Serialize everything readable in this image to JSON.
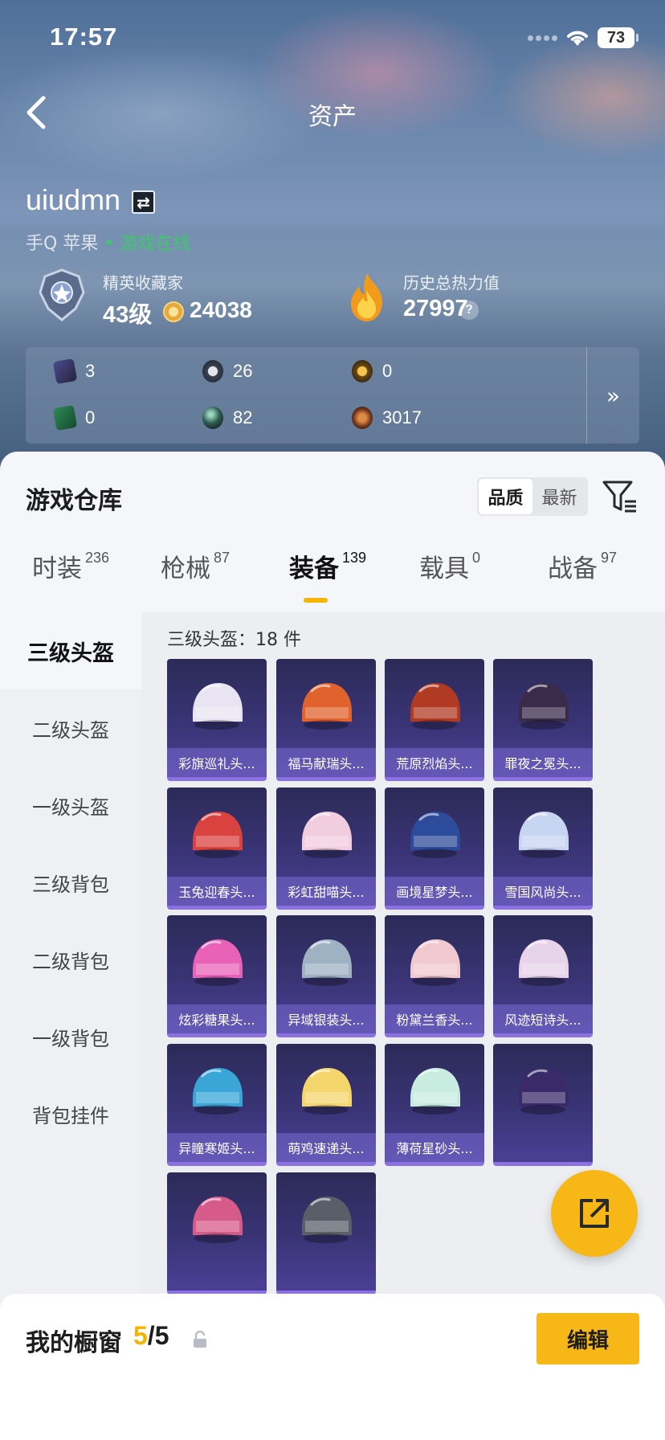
{
  "status_bar": {
    "time": "17:57",
    "battery": "73"
  },
  "header": {
    "title": "资产"
  },
  "user": {
    "name": "uiudmn",
    "switch_symbol": "⇄",
    "platform": "手Q 苹果",
    "separator": "•",
    "online_status": "游戏在线"
  },
  "stats": {
    "rank_label": "精英收藏家",
    "level": "43级",
    "coins": "24038",
    "heat_label": "历史总热力值",
    "heat_value": "27997",
    "help_symbol": "?"
  },
  "resources": [
    {
      "icon": "purple-card-icon",
      "value": "3"
    },
    {
      "icon": "dark-token-icon",
      "value": "26"
    },
    {
      "icon": "gold-token-icon",
      "value": "0"
    },
    {
      "icon": "green-card-icon",
      "value": "0"
    },
    {
      "icon": "green-orb-icon",
      "value": "82"
    },
    {
      "icon": "bronze-coin-icon",
      "value": "3017"
    }
  ],
  "resources_more": "»",
  "warehouse": {
    "title": "游戏仓库",
    "sort_quality": "品质",
    "sort_newest": "最新"
  },
  "tabs": [
    {
      "label": "时装",
      "count": "236"
    },
    {
      "label": "枪械",
      "count": "87"
    },
    {
      "label": "装备",
      "count": "139"
    },
    {
      "label": "载具",
      "count": "0"
    },
    {
      "label": "战备",
      "count": "97"
    }
  ],
  "sidebar": [
    "三级头盔",
    "二级头盔",
    "一级头盔",
    "三级背包",
    "二级背包",
    "一级背包",
    "背包挂件"
  ],
  "content": {
    "count_label": "三级头盔：18 件"
  },
  "items": [
    {
      "name": "彩旗巡礼头...",
      "color": "#e8e4f2"
    },
    {
      "name": "福马献瑞头...",
      "color": "#e2622e"
    },
    {
      "name": "荒原烈焰头...",
      "color": "#b13a22"
    },
    {
      "name": "罪夜之冕头...",
      "color": "#3a2b4a"
    },
    {
      "name": "玉兔迎春头...",
      "color": "#d9423f"
    },
    {
      "name": "彩虹甜喵头...",
      "color": "#f2cde0"
    },
    {
      "name": "画境星梦头...",
      "color": "#2c4b9a"
    },
    {
      "name": "雪国风尚头...",
      "color": "#c7d4f2"
    },
    {
      "name": "炫彩糖果头...",
      "color": "#e962b8"
    },
    {
      "name": "异域银装头...",
      "color": "#9fb2c4"
    },
    {
      "name": "粉黛兰香头...",
      "color": "#f0c8cf"
    },
    {
      "name": "风迹短诗头...",
      "color": "#e7d3ea"
    },
    {
      "name": "异瞳寒姬头...",
      "color": "#3aa6d8"
    },
    {
      "name": "萌鸡速递头...",
      "color": "#f5d66c"
    },
    {
      "name": "薄荷星砂头...",
      "color": "#c8ece0"
    },
    {
      "name": "",
      "color": "#3a2a6a"
    },
    {
      "name": "",
      "color": "#d65a8a"
    },
    {
      "name": "",
      "color": "#5a5e68"
    }
  ],
  "showcase": {
    "title": "我的橱窗",
    "current": "5",
    "total": "/5",
    "edit_label": "编辑"
  },
  "colors": {
    "accent": "#f7b717",
    "online": "#3dc86a",
    "card_bg": "#3a3476"
  }
}
